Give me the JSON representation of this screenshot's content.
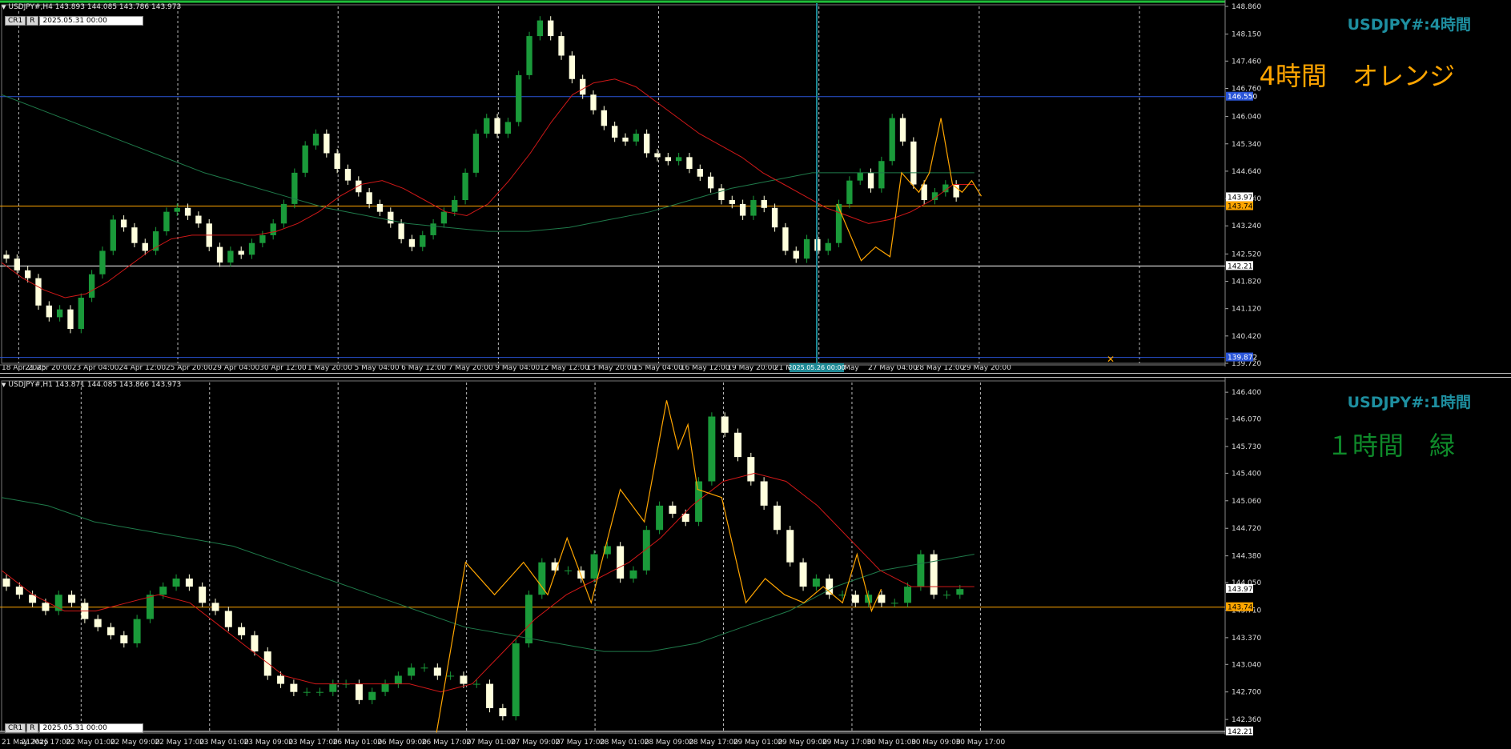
{
  "top": {
    "header": "USDJPY#,H4  143.893 144.085 143.786 143.973",
    "ctrl_cr": "CR1",
    "ctrl_r": "R",
    "ctrl_date": "2025.05.31 00:00",
    "symbol_label": "USDJPY#:4時間",
    "note_label": "4時間　オレンジ",
    "price_ticks": [
      "148.860",
      "148.150",
      "147.460",
      "146.760",
      "146.040",
      "145.340",
      "144.640",
      "143.940",
      "143.240",
      "142.520",
      "141.820",
      "141.120",
      "140.420",
      "139.720"
    ],
    "badges": [
      "146.550",
      "143.973",
      "143.747",
      "142.213",
      "139.872"
    ],
    "time_labels": [
      "18 Apr 2025",
      "21 Apr 20:00",
      "23 Apr 04:00",
      "24 Apr 12:00",
      "25 Apr 20:00",
      "29 Apr 04:00",
      "30 Apr 12:00",
      "1 May 20:00",
      "5 May 04:00",
      "6 May 12:00",
      "7 May 20:00",
      "9 May 04:00",
      "12 May 12:00",
      "13 May 20:00",
      "15 May 04:00",
      "16 May 12:00",
      "19 May 20:00",
      "21 May 04:00",
      "22 May",
      "27 May 04:00",
      "28 May 12:00",
      "29 May 20:00"
    ],
    "crosshair_time": "2025.05.26 00:00",
    "time_tail": "00"
  },
  "bottom": {
    "header": "USDJPY#,H1  143.871 144.085 143.866 143.973",
    "ctrl_cr": "CR1",
    "ctrl_r": "R",
    "ctrl_date": "2025.05.31 00:00",
    "symbol_label": "USDJPY#:1時間",
    "note_label": "１時間　緑",
    "price_ticks": [
      "146.400",
      "146.070",
      "145.730",
      "145.400",
      "145.060",
      "144.720",
      "144.380",
      "144.050",
      "143.710",
      "143.370",
      "143.040",
      "142.700",
      "142.360"
    ],
    "badges": [
      "143.973",
      "143.747",
      "142.213"
    ],
    "time_labels": [
      "21 May 2025",
      "21 May 17:00",
      "22 May 01:00",
      "22 May 09:00",
      "22 May 17:00",
      "23 May 01:00",
      "23 May 09:00",
      "23 May 17:00",
      "26 May 01:00",
      "26 May 09:00",
      "26 May 17:00",
      "27 May 01:00",
      "27 May 09:00",
      "27 May 17:00",
      "28 May 01:00",
      "28 May 09:00",
      "28 May 17:00",
      "29 May 01:00",
      "29 May 09:00",
      "29 May 17:00",
      "30 May 01:00",
      "30 May 09:00",
      "30 May 17:00"
    ]
  },
  "colors": {
    "candle_up": "#1a9a3a",
    "candle_down": "#ffffdd",
    "ma_fast": "#d01818",
    "ma_slow": "#1f7a4a",
    "zigzag": "#ffa500",
    "level_orange": "#ffa500",
    "level_blue": "#2a55d8",
    "level_white": "#ffffff",
    "crosshair": "#1e8a96"
  },
  "chart_data": [
    {
      "type": "candlestick",
      "symbol": "USDJPY#",
      "timeframe": "H4",
      "ylim": [
        139.72,
        148.86
      ],
      "ohlc_last": {
        "open": 143.893,
        "high": 144.085,
        "low": 143.786,
        "close": 143.973
      },
      "levels": [
        146.55,
        143.747,
        142.213,
        139.872
      ],
      "close_path": [
        142.4,
        142.1,
        141.9,
        141.2,
        140.9,
        141.1,
        140.6,
        141.4,
        142.0,
        142.6,
        143.4,
        143.2,
        142.8,
        142.6,
        143.1,
        143.6,
        143.7,
        143.5,
        143.3,
        142.7,
        142.3,
        142.6,
        142.5,
        142.8,
        143.0,
        143.3,
        143.8,
        144.6,
        145.3,
        145.6,
        145.1,
        144.7,
        144.4,
        144.1,
        143.8,
        143.6,
        143.3,
        142.9,
        142.7,
        143.0,
        143.3,
        143.6,
        143.9,
        144.6,
        145.6,
        146.0,
        145.6,
        145.9,
        147.1,
        148.1,
        148.5,
        148.1,
        147.6,
        147.0,
        146.6,
        146.2,
        145.8,
        145.5,
        145.4,
        145.6,
        145.1,
        145.0,
        144.9,
        145.0,
        144.7,
        144.5,
        144.2,
        143.9,
        143.8,
        143.5,
        143.9,
        143.7,
        143.2,
        142.6,
        142.4,
        142.9,
        142.6,
        142.8,
        143.8,
        144.4,
        144.6,
        144.2,
        144.9,
        146.0,
        145.4,
        144.3,
        143.9,
        144.1,
        144.3,
        143.97
      ],
      "ma_fast": [
        142.3,
        141.9,
        141.6,
        141.4,
        141.5,
        141.8,
        142.2,
        142.6,
        142.9,
        143.0,
        143.0,
        143.0,
        143.0,
        143.1,
        143.3,
        143.6,
        144.0,
        144.3,
        144.4,
        144.2,
        143.9,
        143.6,
        143.5,
        143.8,
        144.4,
        145.1,
        145.9,
        146.6,
        146.9,
        147.0,
        146.8,
        146.4,
        146.0,
        145.6,
        145.3,
        145.0,
        144.6,
        144.3,
        144.0,
        143.7,
        143.5,
        143.3,
        143.4,
        143.6,
        143.9,
        144.3,
        144.3
      ],
      "ma_slow": [
        146.6,
        146.2,
        145.8,
        145.4,
        145.0,
        144.6,
        144.3,
        144.0,
        143.7,
        143.5,
        143.3,
        143.2,
        143.1,
        143.1,
        143.2,
        143.4,
        143.6,
        143.9,
        144.2,
        144.4,
        144.6,
        144.6,
        144.6,
        144.6,
        144.6
      ],
      "zigzag": [
        [
          0.87,
          143.8
        ],
        [
          0.895,
          142.35
        ],
        [
          0.91,
          142.7
        ],
        [
          0.925,
          142.45
        ],
        [
          0.937,
          144.6
        ],
        [
          0.955,
          144.1
        ],
        [
          0.966,
          144.6
        ],
        [
          0.978,
          146.0
        ],
        [
          0.99,
          144.3
        ],
        [
          1.0,
          144.1
        ],
        [
          1.01,
          144.4
        ],
        [
          1.02,
          144.0
        ]
      ]
    },
    {
      "type": "candlestick",
      "symbol": "USDJPY#",
      "timeframe": "H1",
      "ylim": [
        142.213,
        146.52
      ],
      "ohlc_last": {
        "open": 143.871,
        "high": 144.085,
        "low": 143.866,
        "close": 143.973
      },
      "levels": [
        143.747,
        142.213
      ],
      "close_path": [
        144.0,
        143.9,
        143.8,
        143.7,
        143.9,
        143.8,
        143.6,
        143.5,
        143.4,
        143.3,
        143.6,
        143.9,
        144.0,
        144.1,
        144.0,
        143.8,
        143.7,
        143.5,
        143.4,
        143.2,
        142.9,
        142.8,
        142.7,
        142.7,
        142.7,
        142.8,
        142.8,
        142.6,
        142.7,
        142.8,
        142.9,
        143.0,
        143.0,
        142.9,
        142.9,
        142.8,
        142.8,
        142.5,
        142.4,
        143.3,
        143.9,
        144.3,
        144.2,
        144.2,
        144.1,
        144.4,
        144.5,
        144.1,
        144.2,
        144.7,
        145.0,
        144.9,
        144.8,
        145.3,
        146.1,
        145.9,
        145.6,
        145.3,
        145.0,
        144.7,
        144.3,
        144.0,
        144.1,
        143.9,
        143.9,
        143.8,
        143.9,
        143.8,
        143.8,
        144.0,
        144.4,
        143.9,
        143.9,
        143.97
      ],
      "ma_fast": [
        144.2,
        143.9,
        143.7,
        143.7,
        143.8,
        143.9,
        143.8,
        143.5,
        143.2,
        142.9,
        142.8,
        142.8,
        142.8,
        142.8,
        142.7,
        142.8,
        143.2,
        143.6,
        143.9,
        144.1,
        144.3,
        144.6,
        145.0,
        145.3,
        145.4,
        145.3,
        145.0,
        144.6,
        144.2,
        144.0,
        144.0,
        144.0
      ],
      "ma_slow": [
        145.1,
        145.0,
        144.8,
        144.7,
        144.6,
        144.5,
        144.3,
        144.1,
        143.9,
        143.7,
        143.5,
        143.4,
        143.3,
        143.2,
        143.2,
        143.3,
        143.5,
        143.7,
        144.0,
        144.2,
        144.3,
        144.4
      ],
      "zigzag": [
        [
          0.45,
          142.2
        ],
        [
          0.48,
          144.3
        ],
        [
          0.51,
          143.9
        ],
        [
          0.54,
          144.3
        ],
        [
          0.565,
          143.9
        ],
        [
          0.585,
          144.6
        ],
        [
          0.61,
          143.8
        ],
        [
          0.64,
          145.2
        ],
        [
          0.665,
          144.8
        ],
        [
          0.688,
          146.3
        ],
        [
          0.7,
          145.7
        ],
        [
          0.71,
          146.0
        ],
        [
          0.72,
          145.2
        ],
        [
          0.745,
          145.1
        ],
        [
          0.77,
          143.8
        ],
        [
          0.79,
          144.1
        ],
        [
          0.81,
          143.9
        ],
        [
          0.83,
          143.8
        ],
        [
          0.85,
          144.0
        ],
        [
          0.87,
          143.8
        ],
        [
          0.885,
          144.4
        ],
        [
          0.9,
          143.7
        ],
        [
          0.91,
          143.97
        ]
      ]
    }
  ]
}
